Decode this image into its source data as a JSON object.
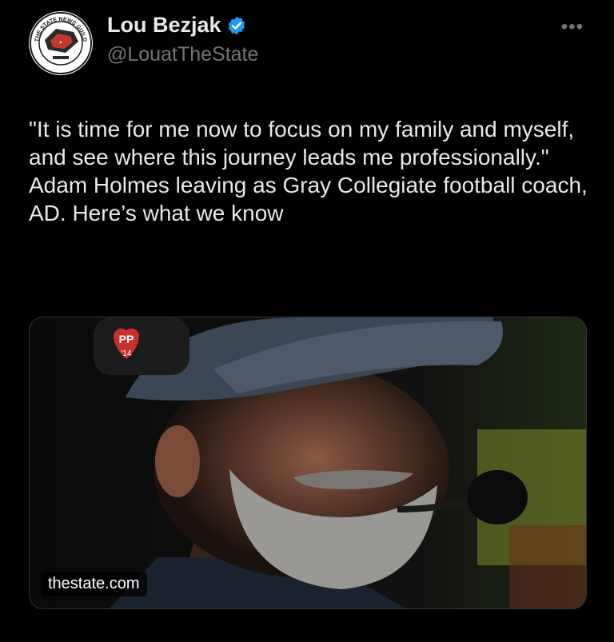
{
  "author": {
    "name": "Lou Bezjak",
    "handle": "@LouatTheState",
    "avatar_logo_text": "THE STATE NEWS GUILD"
  },
  "tweet": {
    "quote": "\"It is time for me now to focus on my family and myself, and see where this journey leads me professionally.\"",
    "headline": "Adam Holmes leaving as Gray Collegiate football coach, AD. Here’s what we know"
  },
  "media": {
    "source_label": "thestate.com",
    "headset_sticker_text": "PP",
    "headset_sticker_number": "'14"
  },
  "icons": {
    "verified": "verified-badge-icon",
    "more": "more-options-icon"
  },
  "colors": {
    "background": "#000000",
    "text": "#e7e9ea",
    "secondary": "#71767b",
    "verified": "#1d9bf0"
  }
}
